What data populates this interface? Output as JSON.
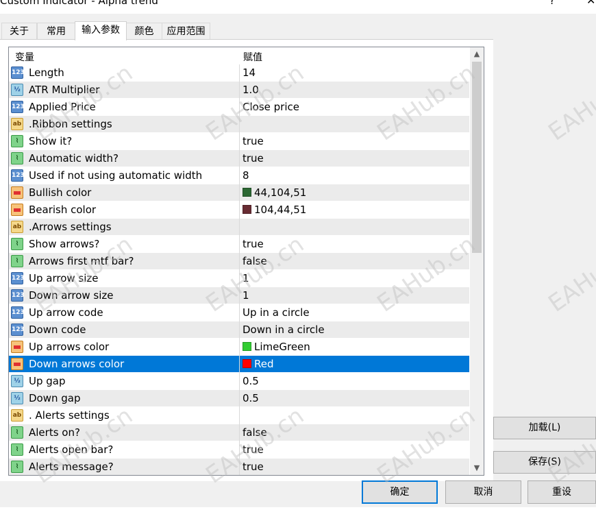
{
  "window": {
    "title": "Custom Indicator - Alpha trend",
    "help": "?",
    "close": "✕"
  },
  "tabs": [
    {
      "label": "关于",
      "active": false
    },
    {
      "label": "常用",
      "active": false
    },
    {
      "label": "输入参数",
      "active": true
    },
    {
      "label": "颜色",
      "active": false
    },
    {
      "label": "应用范围",
      "active": false
    }
  ],
  "table": {
    "header": {
      "name": "变量",
      "value": "赋值"
    },
    "rows": [
      {
        "icon": "int",
        "name": "Length",
        "value": "14"
      },
      {
        "icon": "dbl",
        "name": "ATR Multiplier",
        "value": "1.0"
      },
      {
        "icon": "int",
        "name": "Applied Price",
        "value": "Close price"
      },
      {
        "icon": "str",
        "name": ".Ribbon settings",
        "value": ""
      },
      {
        "icon": "bool",
        "name": "Show it?",
        "value": "true"
      },
      {
        "icon": "bool",
        "name": "Automatic width?",
        "value": "true"
      },
      {
        "icon": "int",
        "name": "Used if not using automatic width",
        "value": "8"
      },
      {
        "icon": "col",
        "name": "Bullish color",
        "value": "44,104,51",
        "swatch": "#2c6833"
      },
      {
        "icon": "col",
        "name": "Bearish color",
        "value": "104,44,51",
        "swatch": "#682c33"
      },
      {
        "icon": "str",
        "name": ".Arrows settings",
        "value": ""
      },
      {
        "icon": "bool",
        "name": "Show arrows?",
        "value": "true"
      },
      {
        "icon": "bool",
        "name": "Arrows first mtf bar?",
        "value": "false"
      },
      {
        "icon": "int",
        "name": "Up arrow size",
        "value": "1"
      },
      {
        "icon": "int",
        "name": "Down arrow size",
        "value": "1"
      },
      {
        "icon": "int",
        "name": "Up arrow code",
        "value": "Up in a circle"
      },
      {
        "icon": "int",
        "name": "Down code",
        "value": "Down in a circle"
      },
      {
        "icon": "col",
        "name": "Up arrows color",
        "value": "LimeGreen",
        "swatch": "#32cd32"
      },
      {
        "icon": "col",
        "name": "Down arrows color",
        "value": "Red",
        "swatch": "#ff0000",
        "selected": true
      },
      {
        "icon": "dbl",
        "name": "Up gap",
        "value": "0.5"
      },
      {
        "icon": "dbl",
        "name": "Down gap",
        "value": "0.5"
      },
      {
        "icon": "str",
        "name": ". Alerts settings",
        "value": ""
      },
      {
        "icon": "bool",
        "name": "Alerts on?",
        "value": "false"
      },
      {
        "icon": "bool",
        "name": "Alerts open bar?",
        "value": "true"
      },
      {
        "icon": "bool",
        "name": "Alerts message?",
        "value": "true"
      }
    ]
  },
  "icon_text": {
    "int": "123",
    "dbl": "½",
    "str": "ab",
    "bool": "⌇",
    "col": ""
  },
  "buttons": {
    "load": "加载(L)",
    "save": "保存(S)",
    "ok": "确定",
    "cancel": "取消",
    "reset": "重设"
  },
  "watermark": "EAHub.cn",
  "colors": {
    "selection": "#0078d7",
    "alt_row": "#ebebeb"
  }
}
